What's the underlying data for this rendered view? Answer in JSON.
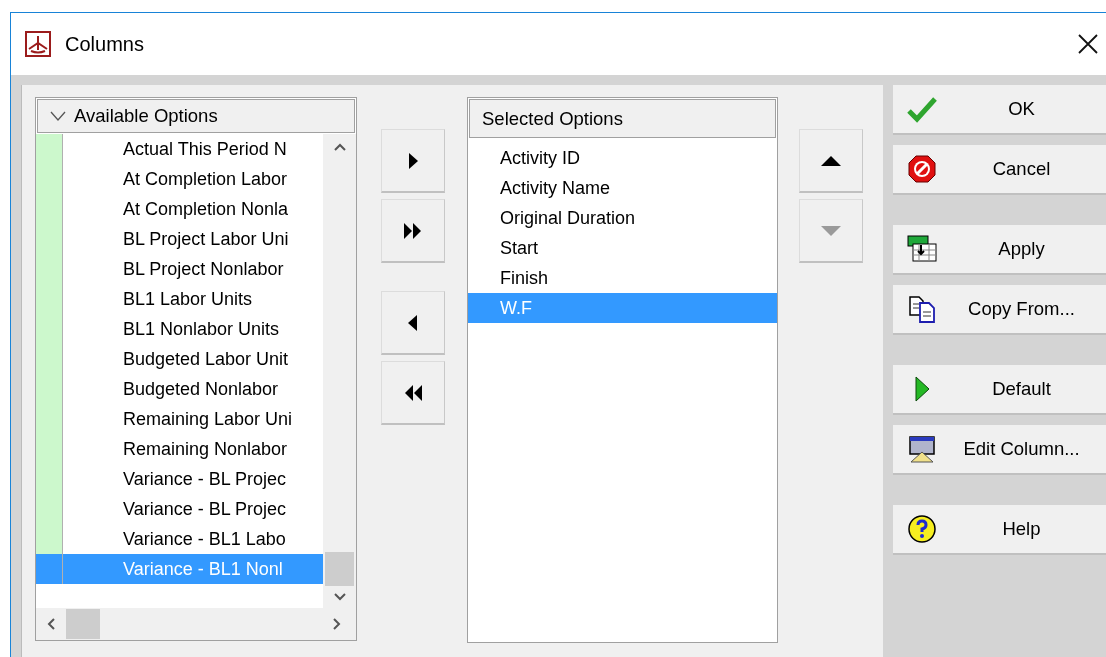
{
  "window": {
    "title": "Columns"
  },
  "available": {
    "header": "Available Options",
    "expanded": true,
    "items": [
      {
        "label": "Actual This Period N",
        "selected": false
      },
      {
        "label": "At Completion Labor",
        "selected": false
      },
      {
        "label": "At Completion Nonla",
        "selected": false
      },
      {
        "label": "BL Project Labor Uni",
        "selected": false
      },
      {
        "label": "BL Project Nonlabor",
        "selected": false
      },
      {
        "label": "BL1 Labor Units",
        "selected": false
      },
      {
        "label": "BL1 Nonlabor Units",
        "selected": false
      },
      {
        "label": "Budgeted Labor Unit",
        "selected": false
      },
      {
        "label": "Budgeted Nonlabor",
        "selected": false
      },
      {
        "label": "Remaining Labor Uni",
        "selected": false
      },
      {
        "label": "Remaining Nonlabor",
        "selected": false
      },
      {
        "label": "Variance - BL Projec",
        "selected": false
      },
      {
        "label": "Variance - BL Projec",
        "selected": false
      },
      {
        "label": "Variance - BL1 Labo",
        "selected": false
      },
      {
        "label": "Variance - BL1 Nonl",
        "selected": true
      }
    ]
  },
  "transfer_buttons": [
    [
      {
        "kind": "add",
        "disabled": false
      },
      {
        "kind": "add-all",
        "disabled": false
      }
    ],
    [
      {
        "kind": "remove",
        "disabled": false
      },
      {
        "kind": "remove-all",
        "disabled": false
      }
    ]
  ],
  "selected": {
    "header": "Selected Options",
    "items": [
      {
        "label": "Activity ID",
        "selected": false
      },
      {
        "label": "Activity Name",
        "selected": false
      },
      {
        "label": "Original Duration",
        "selected": false
      },
      {
        "label": "Start",
        "selected": false
      },
      {
        "label": "Finish",
        "selected": false
      },
      {
        "label": "W.F",
        "selected": true
      }
    ]
  },
  "order_buttons": [
    {
      "kind": "up",
      "disabled": false
    },
    {
      "kind": "down",
      "disabled": true
    }
  ],
  "button_groups": [
    [
      {
        "label": "OK",
        "kind": "check"
      },
      {
        "label": "Cancel",
        "kind": "stop"
      }
    ],
    [
      {
        "label": "Apply",
        "kind": "apply"
      },
      {
        "label": "Copy From...",
        "kind": "copy"
      }
    ],
    [
      {
        "label": "Default",
        "kind": "play"
      },
      {
        "label": "Edit Column...",
        "kind": "edit"
      }
    ],
    [
      {
        "label": "Help",
        "kind": "help"
      }
    ]
  ]
}
